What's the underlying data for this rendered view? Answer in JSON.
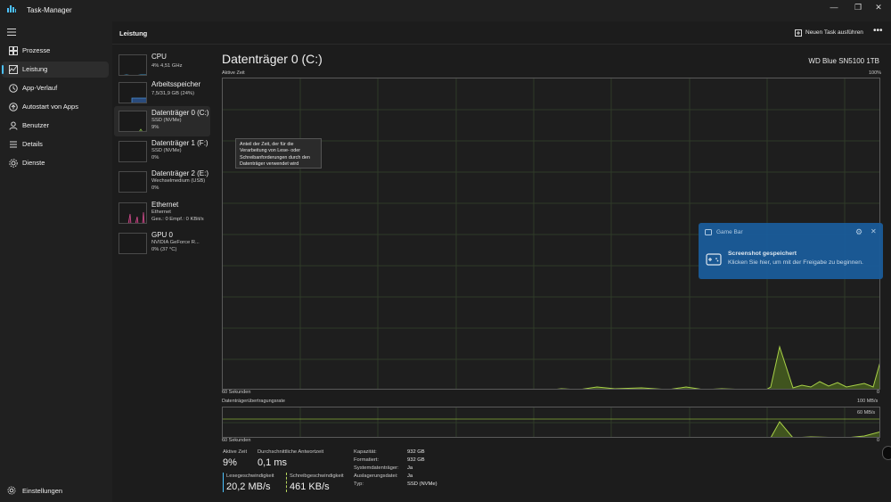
{
  "window": {
    "title": "Task-Manager",
    "minimize": "—",
    "maximize": "❐",
    "close": "✕"
  },
  "nav": {
    "items": [
      {
        "label": "Prozesse",
        "icon": "processes-icon"
      },
      {
        "label": "Leistung",
        "icon": "performance-icon",
        "active": true
      },
      {
        "label": "App-Verlauf",
        "icon": "history-icon"
      },
      {
        "label": "Autostart von Apps",
        "icon": "startup-icon"
      },
      {
        "label": "Benutzer",
        "icon": "users-icon"
      },
      {
        "label": "Details",
        "icon": "details-icon"
      },
      {
        "label": "Dienste",
        "icon": "services-icon"
      }
    ],
    "settings": "Einstellungen"
  },
  "header": {
    "title": "Leistung",
    "new_task": "Neuen Task ausführen",
    "more": "•••"
  },
  "devices": [
    {
      "name": "CPU",
      "line1": "4% 4,51 GHz",
      "line2": ""
    },
    {
      "name": "Arbeitsspeicher",
      "line1": "7,5/31,9 GB (24%)",
      "line2": ""
    },
    {
      "name": "Datenträger 0 (C:)",
      "line1": "SSD (NVMe)",
      "line2": "9%"
    },
    {
      "name": "Datenträger 1 (F:)",
      "line1": "SSD (NVMe)",
      "line2": "0%"
    },
    {
      "name": "Datenträger 2 (E:)",
      "line1": "Wechselmedium (USB)",
      "line2": "0%"
    },
    {
      "name": "Ethernet",
      "line1": "Ethernet",
      "line2": "Ges.: 0 Empf.: 0 KBit/s"
    },
    {
      "name": "GPU 0",
      "line1": "NVIDIA GeForce R...",
      "line2": "0% (37 °C)"
    }
  ],
  "main": {
    "title": "Datenträger 0 (C:)",
    "model": "WD Blue SN5100 1TB",
    "active_time_label": "Aktive Zeit",
    "max_pct": "100%",
    "seconds_label": "60 Sekunden",
    "zero": "0",
    "transfer_label": "Datenträgerübertragungsrate",
    "transfer_max": "100 MB/s",
    "transfer_mid": "60 MB/s",
    "tooltip": "Anteil der Zeit, der für die Verarbeitung von Lese- oder Schreibanforderungen durch den Datenträger verwendet wird"
  },
  "stats": {
    "active_time": {
      "label": "Aktive Zeit",
      "value": "9%"
    },
    "response": {
      "label": "Durchschnittliche Antwortzeit",
      "value": "0,1 ms"
    },
    "read": {
      "label": "Lesegeschwindigkeit",
      "value": "20,2 MB/s"
    },
    "write": {
      "label": "Schreibgeschwindigkeit",
      "value": "461 KB/s"
    }
  },
  "properties": [
    {
      "key": "Kapazität:",
      "value": "932 GB"
    },
    {
      "key": "Formatiert:",
      "value": "932 GB"
    },
    {
      "key": "Systemdatenträger:",
      "value": "Ja"
    },
    {
      "key": "Auslagerungsdatei:",
      "value": "Ja"
    },
    {
      "key": "Typ:",
      "value": "SSD (NVMe)"
    }
  ],
  "toast": {
    "app": "Game Bar",
    "title": "Screenshot gespeichert",
    "body": "Klicken Sie hier, um mit der Freigabe zu beginnen."
  },
  "colors": {
    "accent": "#4cc2ff",
    "disk": "#8bc34a",
    "toast": "#1a5c9a",
    "read_bar": "#4cc2ff",
    "write_bar": "#b6d55c"
  }
}
